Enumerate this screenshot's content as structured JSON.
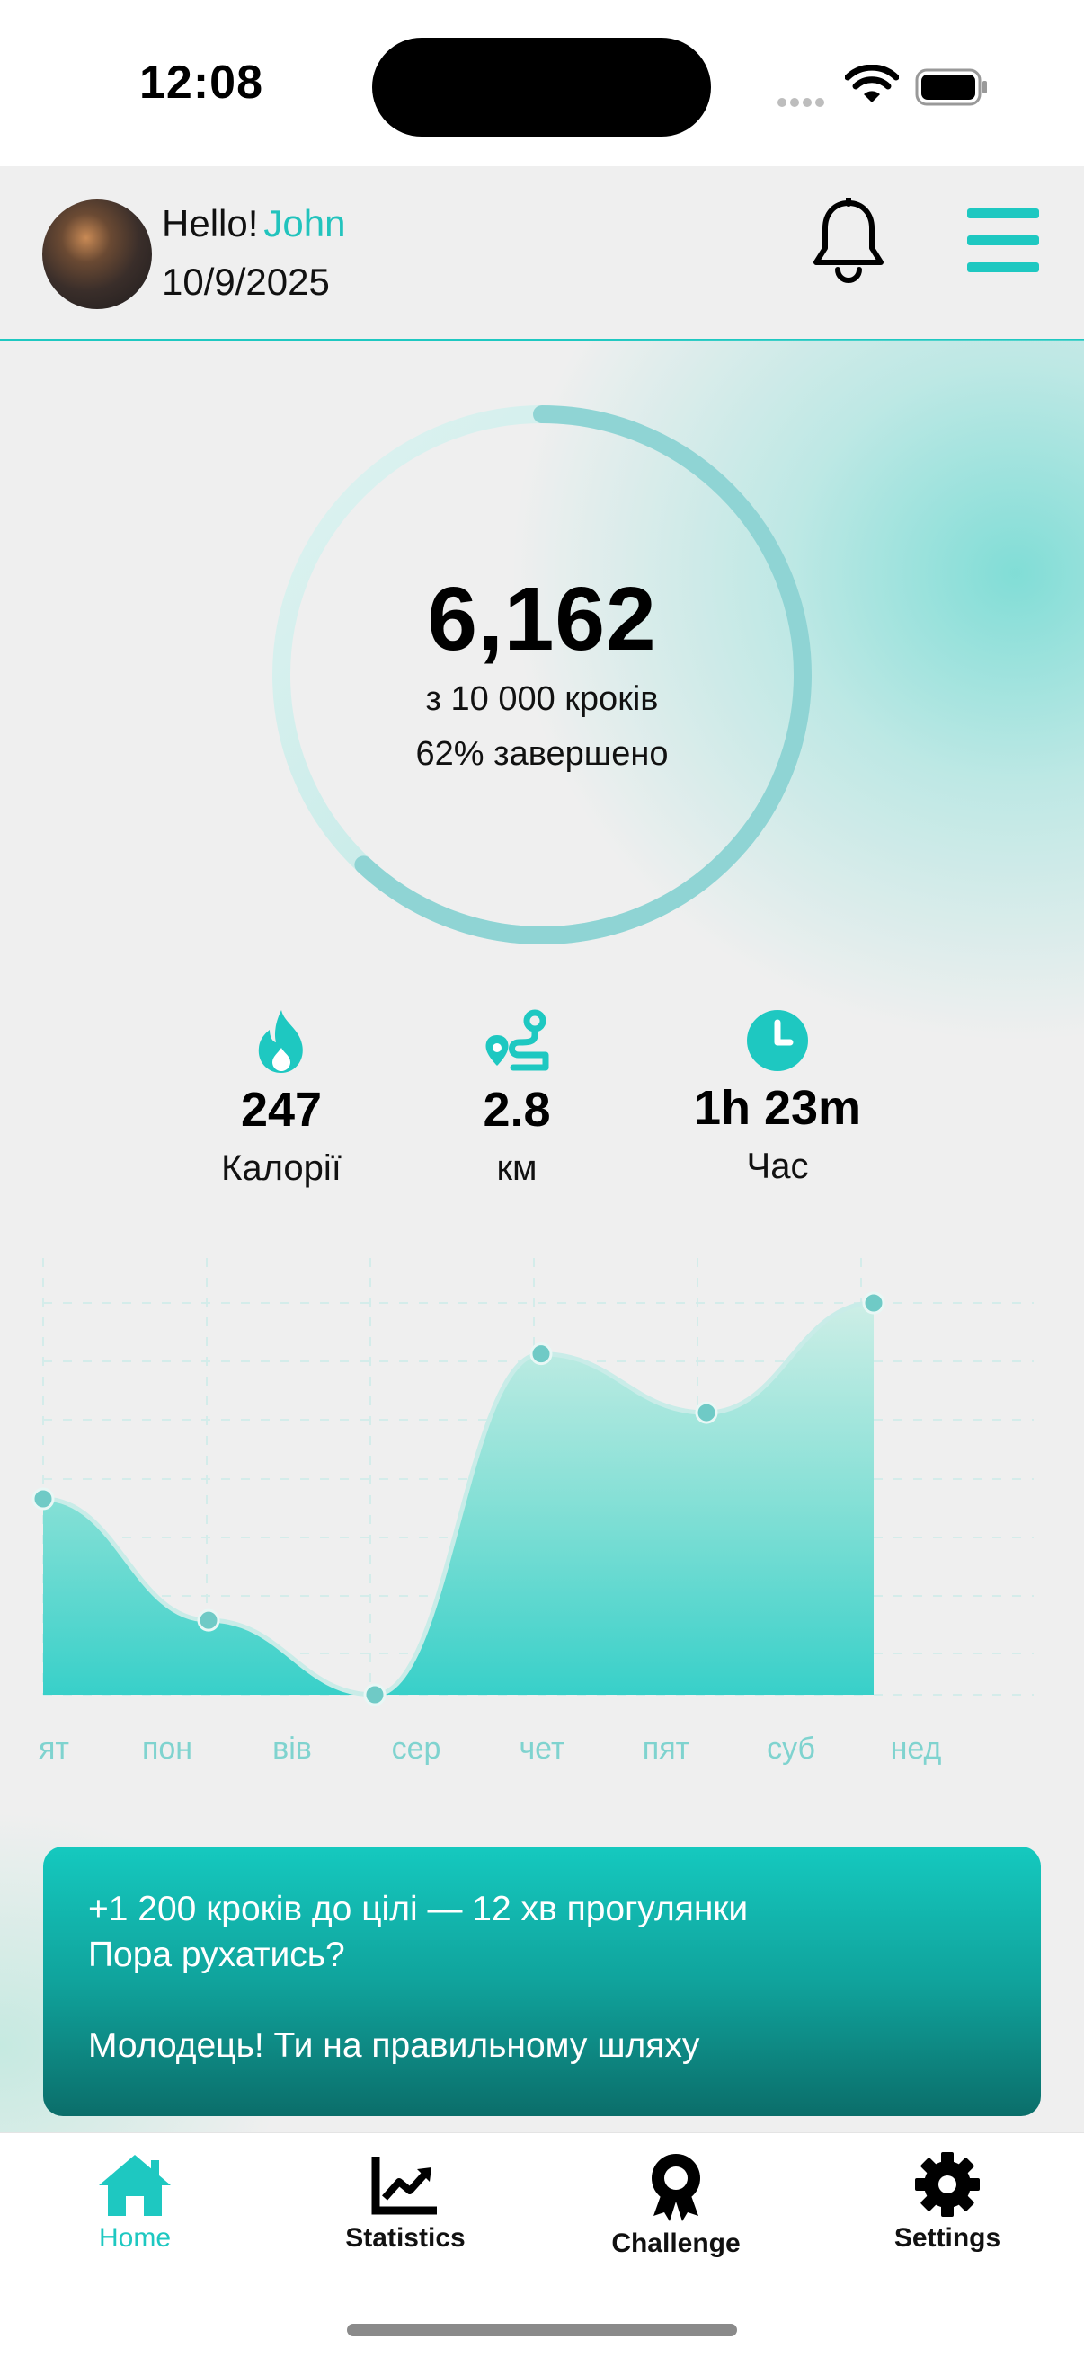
{
  "status_bar": {
    "time": "12:08",
    "icons": [
      "cellular-icon",
      "wifi-icon",
      "battery-icon"
    ]
  },
  "header": {
    "greeting": "Hello!",
    "user_name": "John",
    "date": "10/9/2025",
    "icons": [
      "avatar",
      "bell-icon",
      "menu-icon"
    ]
  },
  "steps": {
    "value": "6,162",
    "goal_text": "з 10 000 кроків",
    "progress_text": "62% завершено",
    "progress_fraction": 0.62
  },
  "metrics": [
    {
      "icon": "flame-icon",
      "value": "247",
      "label": "Калорії"
    },
    {
      "icon": "route-icon",
      "value": "2.8",
      "label": "км"
    },
    {
      "icon": "clock-icon",
      "value": "1h 23m",
      "label": "Час"
    }
  ],
  "chart_data": {
    "type": "area",
    "categories": [
      "ят",
      "пон",
      "вів",
      "сер",
      "чет",
      "пят",
      "суб",
      "нед"
    ],
    "values": [
      0.5,
      0.19,
      0.0,
      0.87,
      0.72,
      1.0
    ],
    "point_categories": [
      "пон",
      "вів",
      "сер",
      "чет",
      "пят",
      "суб"
    ],
    "grid": true,
    "accent": "#1ec8c1"
  },
  "motivation": {
    "line1": "+1 200 кроків до цілі — 12 хв прогулянки",
    "line2": "Пора рухатись?",
    "line3": "Молодець! Ти на правильному шляху"
  },
  "nav": [
    {
      "label": "Home",
      "icon": "home-icon",
      "active": true
    },
    {
      "label": "Statistics",
      "icon": "chart-icon",
      "active": false
    },
    {
      "label": "Challenge",
      "icon": "award-icon",
      "active": false
    },
    {
      "label": "Settings",
      "icon": "gear-icon",
      "active": false
    }
  ],
  "colors": {
    "accent": "#1ec8c1",
    "background": "#efefef",
    "card_top": "#15c9bf",
    "card_bottom": "#0b6e6a"
  }
}
